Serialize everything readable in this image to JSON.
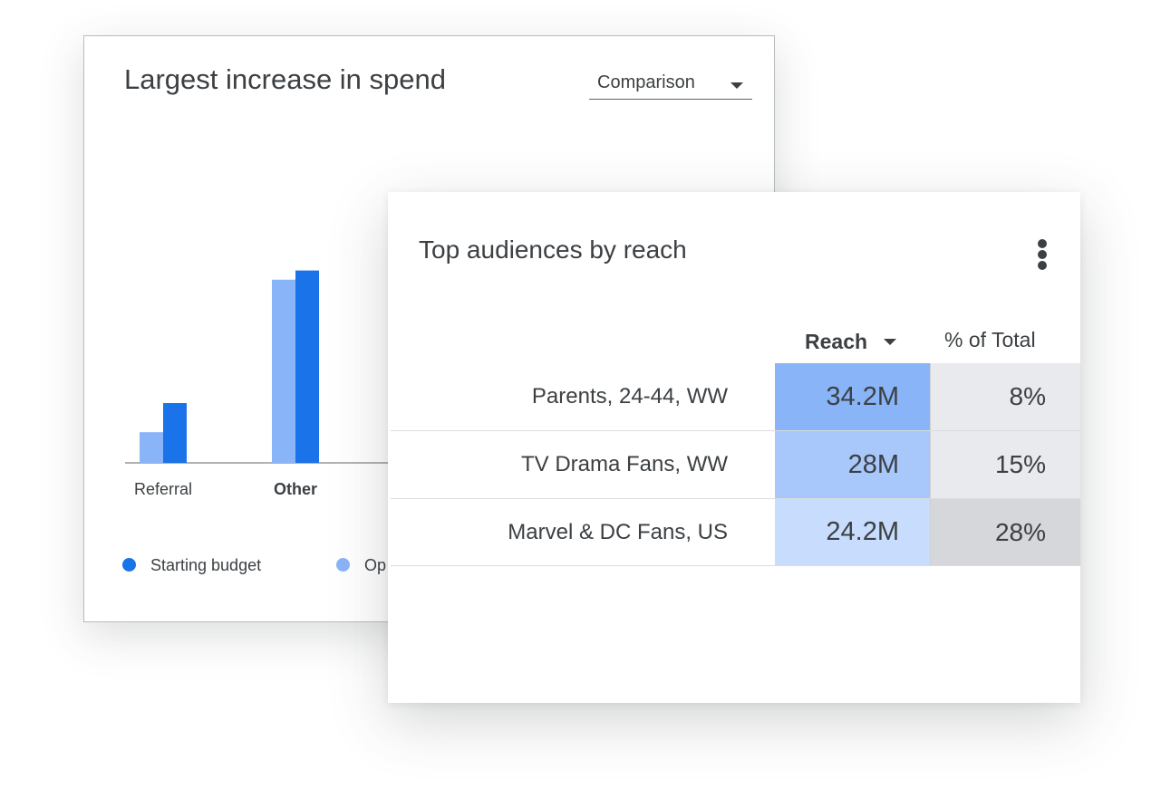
{
  "spend_card": {
    "title": "Largest increase in spend",
    "dropdown": {
      "selected": "Comparison"
    },
    "legend": [
      {
        "label": "Starting budget",
        "color": "#1a73e8"
      },
      {
        "label": "Op",
        "color": "#8ab4f8"
      }
    ]
  },
  "chart_data": {
    "type": "bar",
    "categories": [
      "Referral",
      "Other"
    ],
    "series": [
      {
        "name": "Op",
        "color": "#8ab4f8",
        "values": [
          40,
          239
        ]
      },
      {
        "name": "Starting budget",
        "color": "#1a73e8",
        "values": [
          78,
          251
        ]
      }
    ],
    "title": "Largest increase in spend",
    "bold_category": "Other",
    "ylim": [
      0,
      260
    ]
  },
  "audience_card": {
    "title": "Top audiences by reach",
    "menu_icon": "more-vert-icon",
    "columns": {
      "reach": "Reach",
      "pct_total": "% of Total"
    },
    "rows": [
      {
        "name": "Parents, 24-44, WW",
        "reach": "34.2M",
        "pct": "8%",
        "reach_color": "#8ab4f8",
        "pct_color": "#e8eaed"
      },
      {
        "name": "TV Drama Fans, WW",
        "reach": "28M",
        "pct": "15%",
        "reach_color": "#a8c7fa",
        "pct_color": "#e8eaed"
      },
      {
        "name": "Marvel & DC Fans, US",
        "reach": "24.2M",
        "pct": "28%",
        "reach_color": "#c8dcfd",
        "pct_color": "#d5d7da"
      }
    ]
  }
}
